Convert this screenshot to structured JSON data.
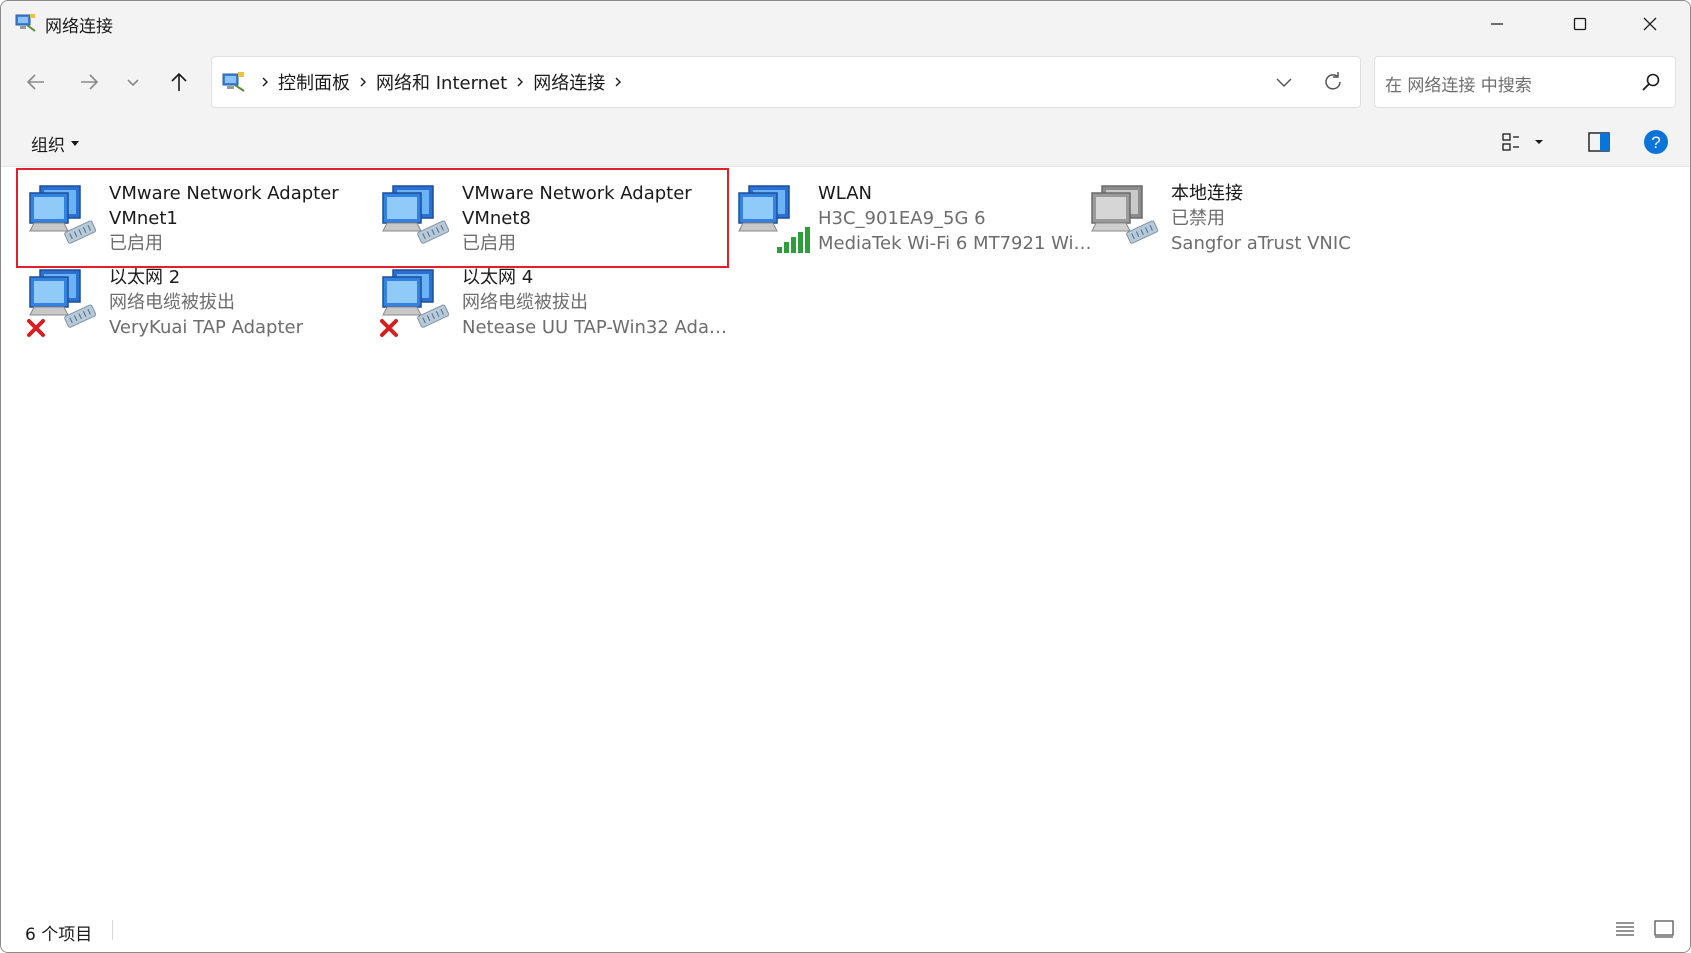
{
  "window": {
    "title": "网络连接"
  },
  "address": {
    "crumbs": [
      "控制面板",
      "网络和 Internet",
      "网络连接"
    ]
  },
  "search": {
    "placeholder": "在 网络连接 中搜索"
  },
  "toolbar": {
    "organize_label": "组织"
  },
  "items": [
    {
      "name_line1": "VMware Network Adapter",
      "name_line2": "VMnet1",
      "status": "已启用",
      "device": "",
      "icon": "ethernet-adapter-icon"
    },
    {
      "name_line1": "VMware Network Adapter",
      "name_line2": "VMnet8",
      "status": "已启用",
      "device": "",
      "icon": "ethernet-adapter-icon"
    },
    {
      "name_line1": "WLAN",
      "name_line2": "",
      "status": "H3C_901EA9_5G 6",
      "device": "MediaTek Wi-Fi 6 MT7921 Wir...",
      "icon": "wifi-adapter-icon"
    },
    {
      "name_line1": "本地连接",
      "name_line2": "",
      "status": "已禁用",
      "device": "Sangfor aTrust VNIC",
      "icon": "disabled-adapter-icon"
    },
    {
      "name_line1": "以太网 2",
      "name_line2": "",
      "status": "网络电缆被拔出",
      "device": "VeryKuai TAP Adapter",
      "icon": "unplugged-adapter-icon"
    },
    {
      "name_line1": "以太网 4",
      "name_line2": "",
      "status": "网络电缆被拔出",
      "device": "Netease UU TAP-Win32 Adapt...",
      "icon": "unplugged-adapter-icon"
    }
  ],
  "status_bar": {
    "item_count": "6 个项目"
  },
  "colors": {
    "highlight_border": "#e0202a",
    "help_blue": "#0a74d8",
    "chrome_bg": "#f3f3f3"
  }
}
